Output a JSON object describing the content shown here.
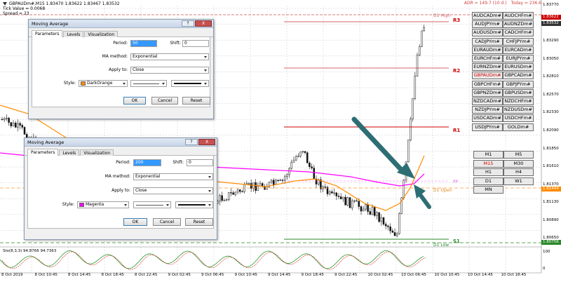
{
  "chart_info": {
    "symbol_line": "GBPAUDm#,M15  1.83470 1.83622 1.83467 1.83532",
    "tick_value": "Tick Value = 0.0068",
    "spread": "Spread = 23"
  },
  "top_right": {
    "adr": "ADR = 149.7  (10 d.)",
    "today": "Today = 236.6"
  },
  "levels": {
    "d1_high": "D1 High",
    "r3": "R3",
    "r2": "R2",
    "r1": "R1",
    "pp": "PP",
    "d1_open": "D1 Open",
    "s1": "S1",
    "d1_low": "D1 Low"
  },
  "price_axis": {
    "labels": [
      "1.83770",
      "1.83410",
      "1.83050",
      "1.82690",
      "1.82330",
      "1.81970",
      "1.81610",
      "1.81250",
      "1.80890",
      "1.80530",
      "1.80170",
      "1.79810",
      "1.79450",
      "1.79090",
      "1.78730",
      "1.78370",
      "1.80695"
    ],
    "current_price": "1.83532",
    "tags": [
      "1.83622",
      "1.83532",
      "1.81444",
      "1.80756"
    ],
    "stoch_scale": [
      "100",
      "0"
    ]
  },
  "time_axis": [
    "8 Oct 2019",
    "8 Oct 10:45",
    "8 Oct 14:45",
    "8 Oct 18:45",
    "8 Oct 22:45",
    "9 Oct 02:45",
    "9 Oct 06:45",
    "9 Oct 10:45",
    "9 Oct 14:45",
    "9 Oct 18:45",
    "9 Oct 22:45",
    "10 Oct 02:45",
    "10 Oct 06:45",
    "10 Oct 10:45",
    "10 Oct 14:45",
    "10 Oct 18:45"
  ],
  "dialog1": {
    "title": "Moving Average",
    "help": "?",
    "close": "X",
    "tabs": [
      "Parameters",
      "Levels",
      "Visualization"
    ],
    "period_label": "Period:",
    "period_value": "50",
    "shift_label": "Shift:",
    "shift_value": "0",
    "method_label": "MA method:",
    "method_value": "Exponential",
    "apply_label": "Apply to:",
    "apply_value": "Close",
    "style_label": "Style:",
    "color_name": "DarkOrange",
    "color_hex": "#ff8c00",
    "ok": "OK",
    "cancel": "Cancel",
    "reset": "Reset"
  },
  "dialog2": {
    "title": "Moving Average",
    "help": "?",
    "close": "X",
    "tabs": [
      "Parameters",
      "Levels",
      "Visualization"
    ],
    "period_label": "Period:",
    "period_value": "200",
    "shift_label": "Shift:",
    "shift_value": "0",
    "method_label": "MA method:",
    "method_value": "Exponential",
    "apply_label": "Apply to:",
    "apply_value": "Close",
    "style_label": "Style:",
    "color_name": "Magenta",
    "color_hex": "#ff00ff",
    "ok": "OK",
    "cancel": "Cancel",
    "reset": "Reset"
  },
  "symbols": [
    [
      "AUDCADm#",
      "AUDCHFm#"
    ],
    [
      "AUDJPYm#",
      "AUDNZDm#"
    ],
    [
      "AUDUSDm#",
      "CADCHFm#"
    ],
    [
      "CADJPYm#",
      "CHFJPYm#"
    ],
    [
      "EURAUDm#",
      "EURCADm#"
    ],
    [
      "EURCHFm#",
      "EURJPYm#"
    ],
    [
      "EURNZDm#",
      "EURUSDm#"
    ],
    [
      "GBPAUDm#",
      "GBPCADm#"
    ],
    [
      "GBPCHFm#",
      "GBPJPYm#"
    ],
    [
      "GBPNZDm#",
      "GBPUSDm#"
    ],
    [
      "NZDCADm#",
      "NZDCHFm#"
    ],
    [
      "NZDJPYm#",
      "NZDUSDm#"
    ],
    [
      "USDCADm#",
      "USDCHFm#"
    ],
    [
      "USDJPYm#",
      "GOLDm#"
    ]
  ],
  "active_symbol": "GBPAUDm#",
  "timeframes": [
    [
      "M1",
      "M5"
    ],
    [
      "M15",
      "M30"
    ],
    [
      "H1",
      "H4"
    ],
    [
      "D1",
      "W1"
    ],
    [
      "MN"
    ]
  ],
  "active_timeframe": "M15",
  "stochastic": {
    "label": "Sto(8,3,3) 94.8766 94.7363"
  },
  "colors": {
    "ma50": "#ff8c00",
    "ma200": "#ff00ff",
    "arrow": "#2d6e74",
    "level_red": "#cc0000",
    "level_green": "#2a8a2a"
  }
}
